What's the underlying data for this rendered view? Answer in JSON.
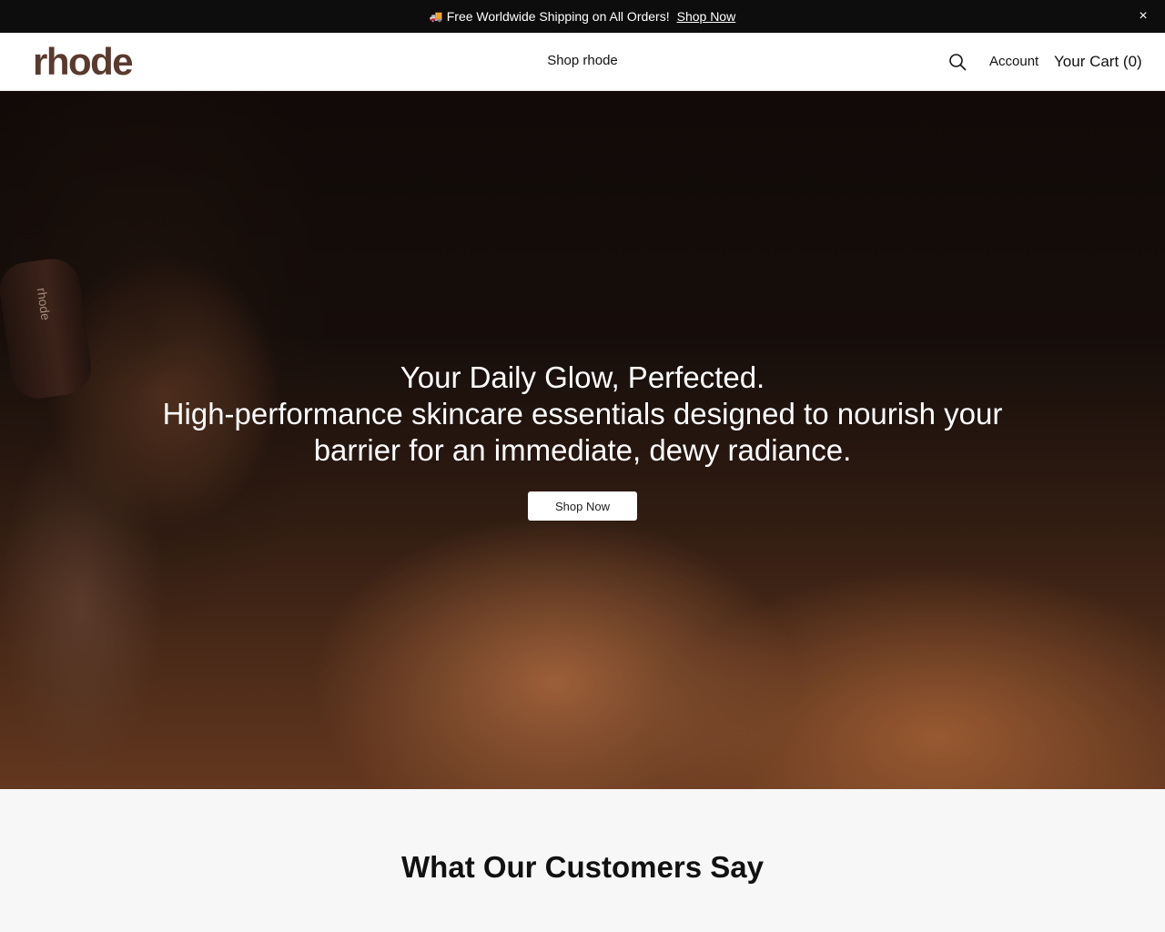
{
  "announcement": {
    "icon": "truck-icon",
    "text": "Free Worldwide Shipping on All Orders!",
    "link_label": "Shop Now",
    "close_label": "×"
  },
  "header": {
    "logo": "rhode",
    "nav_label": "Shop rhode",
    "account_label": "Account",
    "cart_label": "Your Cart (0)"
  },
  "hero": {
    "title": "Your Daily Glow, Perfected.",
    "subtitle": "High-performance skincare essentials designed to nourish your barrier for an immediate, dewy radiance.",
    "button_label": "Shop Now",
    "product_label": "rhode"
  },
  "testimonials": {
    "title": "What Our Customers Say"
  },
  "colors": {
    "announcement_bg": "#0d0d0d",
    "logo": "#5a3a2e",
    "button_bg": "#ffffff",
    "section_bg": "#f7f7f8"
  }
}
